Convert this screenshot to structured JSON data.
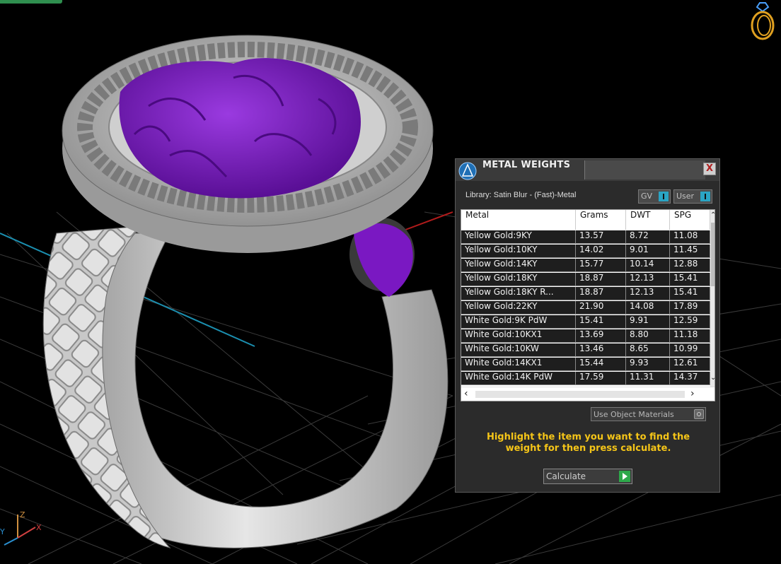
{
  "dialog": {
    "title": "METAL WEIGHTS",
    "close_glyph": "X",
    "library_label": "Library: Satin Blur - (Fast)-Metal",
    "toggles": {
      "gv": "GV",
      "user": "User"
    },
    "table": {
      "headers": [
        "Metal",
        "Grams",
        "DWT",
        "SPG"
      ],
      "rows": [
        [
          "Yellow Gold:9KY",
          "13.57",
          "8.72",
          "11.08"
        ],
        [
          "Yellow Gold:10KY",
          "14.02",
          "9.01",
          "11.45"
        ],
        [
          "Yellow Gold:14KY",
          "15.77",
          "10.14",
          "12.88"
        ],
        [
          "Yellow Gold:18KY",
          "18.87",
          "12.13",
          "15.41"
        ],
        [
          "Yellow Gold:18KY R...",
          "18.87",
          "12.13",
          "15.41"
        ],
        [
          "Yellow Gold:22KY",
          "21.90",
          "14.08",
          "17.89"
        ],
        [
          "White Gold:9K PdW",
          "15.41",
          "9.91",
          "12.59"
        ],
        [
          "White Gold:10KX1",
          "13.69",
          "8.80",
          "11.18"
        ],
        [
          "White Gold:10KW",
          "13.46",
          "8.65",
          "10.99"
        ],
        [
          "White Gold:14KX1",
          "15.44",
          "9.93",
          "12.61"
        ],
        [
          "White Gold:14K PdW",
          "17.59",
          "11.31",
          "14.37"
        ]
      ]
    },
    "use_object_materials": "Use Object Materials",
    "hint": "Highlight the item you want to find the weight for then press calculate.",
    "calculate_label": "Calculate"
  },
  "viewport": {
    "axis_labels": {
      "z": "Z",
      "x": "X",
      "y": "Y"
    },
    "colors": {
      "gem": "#7a18c2",
      "metal": "#bdbdbd",
      "grid": "#3a3a3a",
      "accent": "#f5c518"
    }
  }
}
